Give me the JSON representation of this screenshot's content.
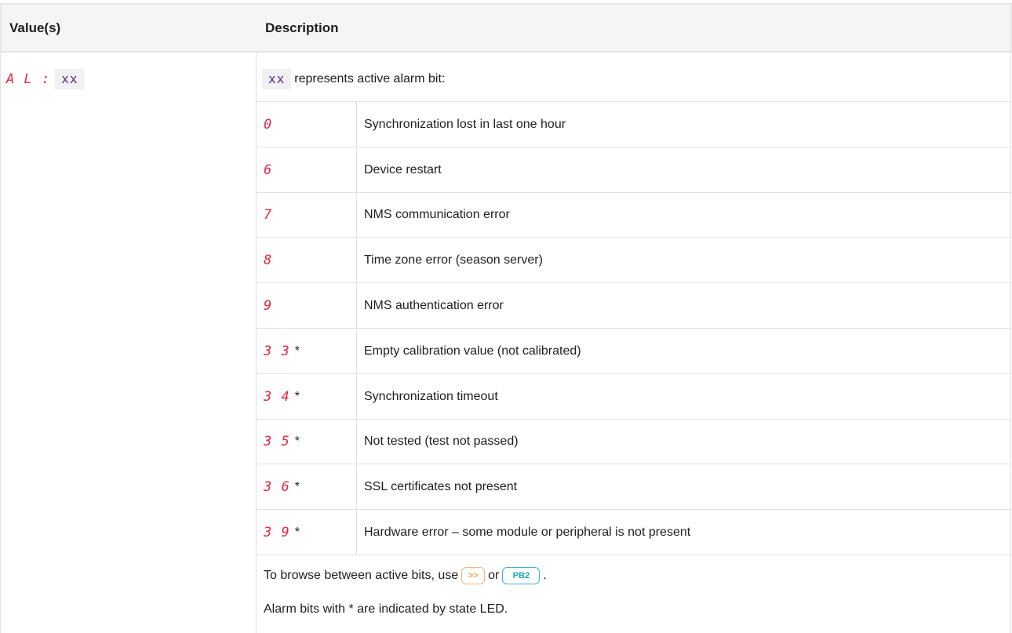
{
  "header": {
    "col1": "Value(s)",
    "col2": "Description"
  },
  "value": {
    "display": "A L :",
    "code": "xx"
  },
  "intro": {
    "code": "xx",
    "text": "represents active alarm bit:"
  },
  "alarms": [
    {
      "code": "0",
      "star": "",
      "desc": "Synchronization lost in last one hour"
    },
    {
      "code": "6",
      "star": "",
      "desc": "Device restart"
    },
    {
      "code": "7",
      "star": "",
      "desc": "NMS communication error"
    },
    {
      "code": "8",
      "star": "",
      "desc": "Time zone error (season server)"
    },
    {
      "code": "9",
      "star": "",
      "desc": "NMS authentication error"
    },
    {
      "code": "3 3",
      "star": "*",
      "desc": "Empty calibration value (not calibrated)"
    },
    {
      "code": "3 4",
      "star": "*",
      "desc": "Synchronization timeout"
    },
    {
      "code": "3 5",
      "star": "*",
      "desc": "Not tested (test not passed)"
    },
    {
      "code": "3 6",
      "star": "*",
      "desc": "SSL certificates not present"
    },
    {
      "code": "3 9",
      "star": "*",
      "desc": "Hardware error – some module or peripheral is not present"
    }
  ],
  "footer": {
    "browse_text": "To browse between active bits, use",
    "button1": ">>",
    "or_text": "or",
    "button2": "PB2",
    "end": ".",
    "note": "Alarm bits with * are indicated by state LED."
  },
  "colors": {
    "segment": "#e8243c",
    "code_text": "#5b2a86",
    "arrow_button": "#f5a055",
    "pb2_button": "#1ea6b8"
  }
}
